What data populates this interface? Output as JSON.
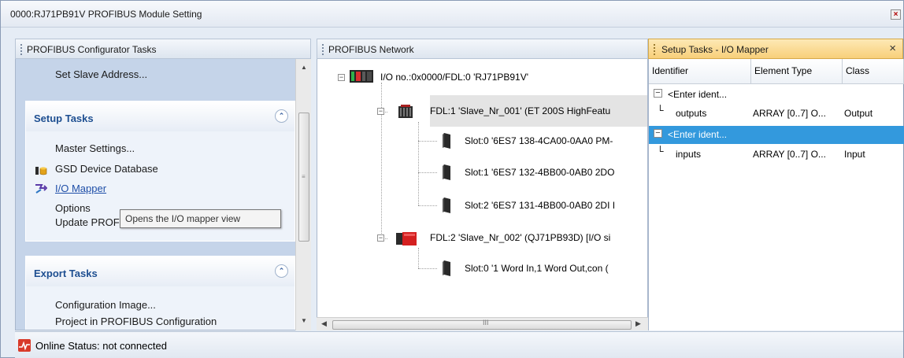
{
  "window": {
    "title": "0000:RJ71PB91V PROFIBUS Module Setting",
    "close_glyph": "×"
  },
  "configurator": {
    "header": "PROFIBUS Configurator Tasks",
    "top_task": "Set Slave Address...",
    "setup": {
      "title": "Setup Tasks",
      "items": [
        "Master Settings...",
        "GSD Device Database",
        "I/O Mapper",
        "Options",
        "Update PROFIBUS Label"
      ]
    },
    "export": {
      "title": "Export Tasks",
      "items": [
        "Configuration Image...",
        "Project in PROFIBUS Configuration"
      ]
    },
    "tooltip": "Opens the I/O mapper view",
    "icons": {
      "gsd": "database-icon",
      "io_mapper": "io-mapper-icon",
      "collapse": "chevron-up-icon"
    }
  },
  "network": {
    "header": "PROFIBUS Network",
    "root": "I/O no.:0x0000/FDL:0 'RJ71PB91V'",
    "slaves": [
      {
        "label": "FDL:1 'Slave_Nr_001' (ET 200S HighFeatu",
        "slots": [
          "Slot:0 '6ES7 138-4CA00-0AA0 PM-",
          "Slot:1 '6ES7 132-4BB00-0AB0  2DO",
          "Slot:2 '6ES7 131-4BB00-0AB0  2DI I"
        ]
      },
      {
        "label": "FDL:2 'Slave_Nr_002' (QJ71PB93D) [I/O si",
        "slots": [
          "Slot:0 '1 Word In,1 Word Out,con ("
        ]
      }
    ],
    "hscroll_grip": "III"
  },
  "mapper": {
    "header": "Setup Tasks - I/O Mapper",
    "close": "×",
    "columns": [
      "Identifier",
      "Element Type",
      "Class"
    ],
    "rows": [
      {
        "kind": "group",
        "expander": "−",
        "identifier": "<Enter ident...",
        "selected": false
      },
      {
        "kind": "item",
        "identifier": "outputs",
        "type": "ARRAY [0..7] O...",
        "class": "Output"
      },
      {
        "kind": "group",
        "expander": "−",
        "identifier": "<Enter ident...",
        "selected": true
      },
      {
        "kind": "item",
        "identifier": "inputs",
        "type": "ARRAY [0..7] O...",
        "class": "Input"
      }
    ],
    "selection_color": "#3399dd"
  },
  "status": {
    "text": "Online Status: not connected",
    "icon": "connection-status-icon"
  }
}
